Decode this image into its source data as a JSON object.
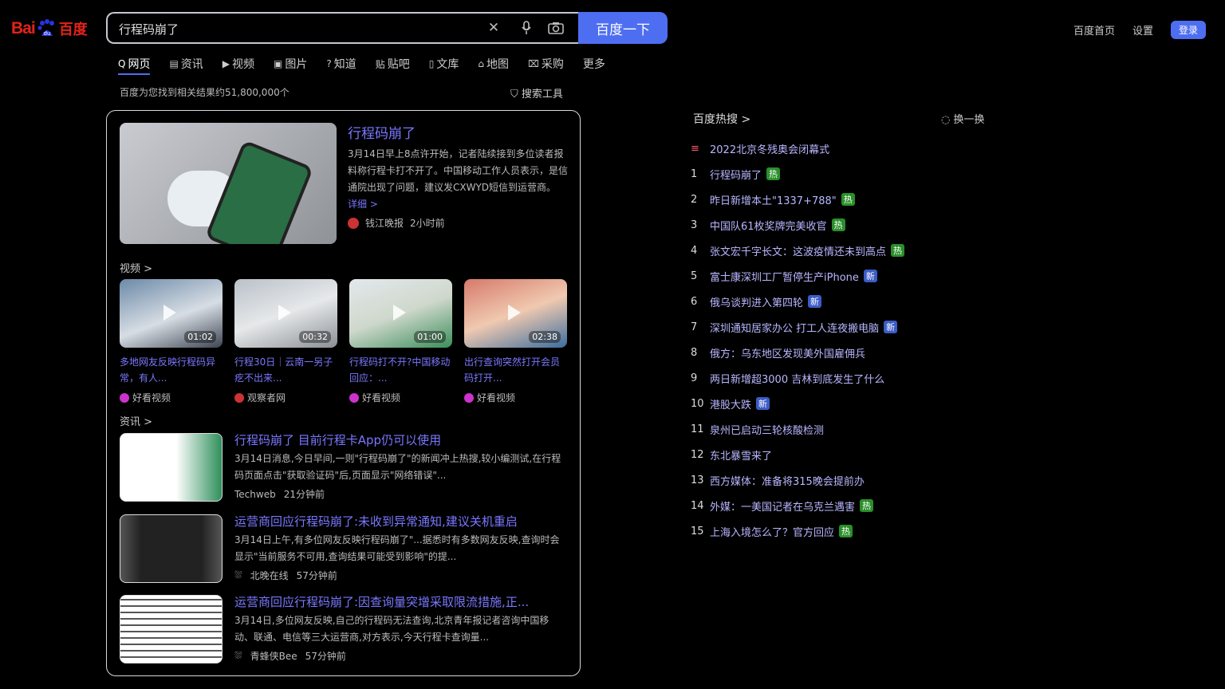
{
  "logo": {
    "bai": "Bai",
    "cn": "百度"
  },
  "search": {
    "query": "行程码崩了",
    "button": "百度一下"
  },
  "topnav": {
    "home": "百度首页",
    "settings": "设置",
    "login": "登录"
  },
  "tabs": [
    {
      "icon": "Q",
      "label": "网页"
    },
    {
      "icon": "▤",
      "label": "资讯"
    },
    {
      "icon": "▶",
      "label": "视频"
    },
    {
      "icon": "▣",
      "label": "图片"
    },
    {
      "icon": "?",
      "label": "知道"
    },
    {
      "icon": "贴",
      "label": "贴吧"
    },
    {
      "icon": "▯",
      "label": "文库"
    },
    {
      "icon": "⌂",
      "label": "地图"
    },
    {
      "icon": "⌧",
      "label": "采购"
    },
    {
      "icon": "",
      "label": "更多"
    }
  ],
  "result_info": "百度为您找到相关结果约51,800,000个",
  "tools": "搜索工具",
  "lead": {
    "title": "行程码崩了",
    "body": "3月14日早上8点许开始，记者陆续接到多位读者报料称行程卡打不开了。中国移动工作人员表示，是信通院出现了问题，建议发CXWYD短信到运营商。",
    "more": "详细 >",
    "source": "钱江晚报",
    "time": "2小时前"
  },
  "video_section": "视频 >",
  "videos": [
    {
      "duration": "01:02",
      "title": "多地网友反映行程码异常，有人...",
      "source": "好看视频"
    },
    {
      "duration": "00:32",
      "title": "行程30日｜云南一另子疙不出来...",
      "source": "观察者网"
    },
    {
      "duration": "01:00",
      "title": "行程码打不开?中国移动回应：...",
      "source": "好看视频"
    },
    {
      "duration": "02:38",
      "title": "出行查询突然打开会员码打开...",
      "source": "好看视频"
    }
  ],
  "news_section": "资讯 >",
  "news": [
    {
      "title": "行程码崩了 目前行程卡App仍可以使用",
      "body": "3月14日消息,今日早间,一则\"行程码崩了\"的新闻冲上热搜,较小编测试,在行程码页面点击\"获取验证码\"后,页面显示\"网络错误\"...",
      "source": "Techweb",
      "time": "21分钟前"
    },
    {
      "title": "运营商回应行程码崩了:未收到异常通知,建议关机重启",
      "body": "3月14日上午,有多位网友反映行程码崩了\"...据悉时有多数网友反映,查询时会显示\"当前服务不可用,查询结果可能受到影响\"的提...",
      "source": "北晚在线",
      "time": "57分钟前"
    },
    {
      "title": "运营商回应行程码崩了:因查询量突增采取限流措施,正...",
      "body": "3月14日,多位网友反映,自己的行程码无法查询,北京青年报记者咨询中国移动、联通、电信等三大运营商,对方表示,今天行程卡查询量...",
      "source": "青蜂侠Bee",
      "time": "57分钟前"
    }
  ],
  "hot": {
    "title": "百度热搜 >",
    "refresh": "换一换",
    "items": [
      {
        "rank": "≡",
        "text": "2022北京冬残奥会闭幕式",
        "badge": ""
      },
      {
        "rank": "1",
        "text": "行程码崩了",
        "badge": "热"
      },
      {
        "rank": "2",
        "text": "昨日新增本土\"1337+788\"",
        "badge": "热"
      },
      {
        "rank": "3",
        "text": "中国队61枚奖牌完美收官",
        "badge": "热"
      },
      {
        "rank": "4",
        "text": "张文宏千字长文：这波疫情还未到高点",
        "badge": "热"
      },
      {
        "rank": "5",
        "text": "富士康深圳工厂暂停生产iPhone",
        "badge": "新"
      },
      {
        "rank": "6",
        "text": "俄乌谈判进入第四轮",
        "badge": "新"
      },
      {
        "rank": "7",
        "text": "深圳通知居家办公 打工人连夜搬电脑",
        "badge": "新"
      },
      {
        "rank": "8",
        "text": "俄方：乌东地区发现美外国雇佣兵",
        "badge": ""
      },
      {
        "rank": "9",
        "text": "两日新增超3000 吉林到底发生了什么",
        "badge": ""
      },
      {
        "rank": "10",
        "text": "港股大跌",
        "badge": "新"
      },
      {
        "rank": "11",
        "text": "泉州已启动三轮核酸检测",
        "badge": ""
      },
      {
        "rank": "12",
        "text": "东北暴雪来了",
        "badge": ""
      },
      {
        "rank": "13",
        "text": "西方媒体：准备将315晚会提前办",
        "badge": ""
      },
      {
        "rank": "14",
        "text": "外媒：一美国记者在乌克兰遇害",
        "badge": "热"
      },
      {
        "rank": "15",
        "text": "上海入境怎么了？官方回应",
        "badge": "热"
      }
    ]
  },
  "colors": {
    "accent": "#4e6ef2",
    "link": "#7a77ff",
    "hot_badge": "#2a8f2a",
    "new_badge": "#3b5cc7"
  }
}
